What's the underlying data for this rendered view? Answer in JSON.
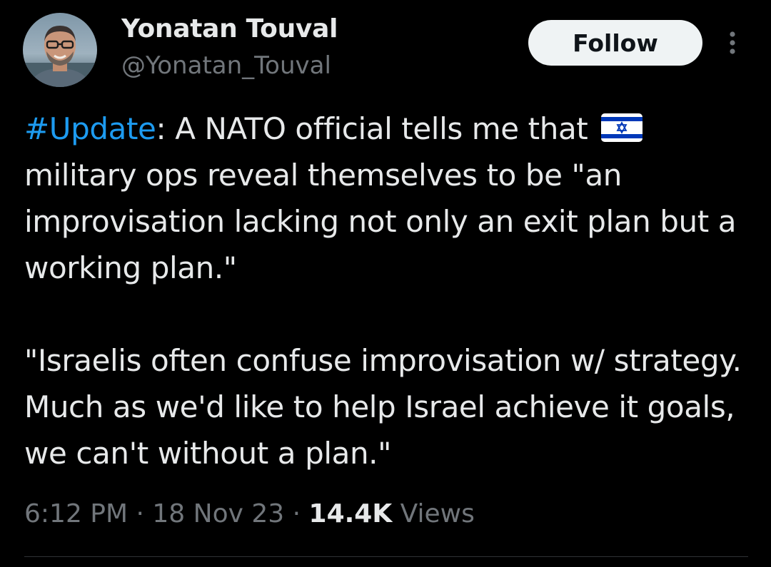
{
  "author": {
    "display_name": "Yonatan Touval",
    "handle": "@Yonatan_Touval",
    "avatar_icon": "profile-photo"
  },
  "actions": {
    "follow_label": "Follow",
    "more_icon": "more-vertical-icon"
  },
  "tweet": {
    "hashtag": "#Update",
    "line1_rest": ":  A NATO official tells me that ",
    "flag_icon": "israel-flag-emoji",
    "line1_after_flag": "military ops reveal themselves to be \"an improvisation lacking not only an exit plan but a working plan.\"",
    "paragraph2": "\"Israelis often confuse improvisation w/ strategy. Much as we'd like to help Israel achieve it goals, we can't without a plan.\""
  },
  "meta": {
    "time": "6:12 PM",
    "separator": " · ",
    "date": "18 Nov 23",
    "views_count": "14.4K",
    "views_label": " Views"
  },
  "colors": {
    "background": "#000000",
    "text_primary": "#e7e9ea",
    "text_secondary": "#71767b",
    "link": "#1d9bf0",
    "follow_button_bg": "#eff3f4",
    "divider": "#2f3336"
  }
}
